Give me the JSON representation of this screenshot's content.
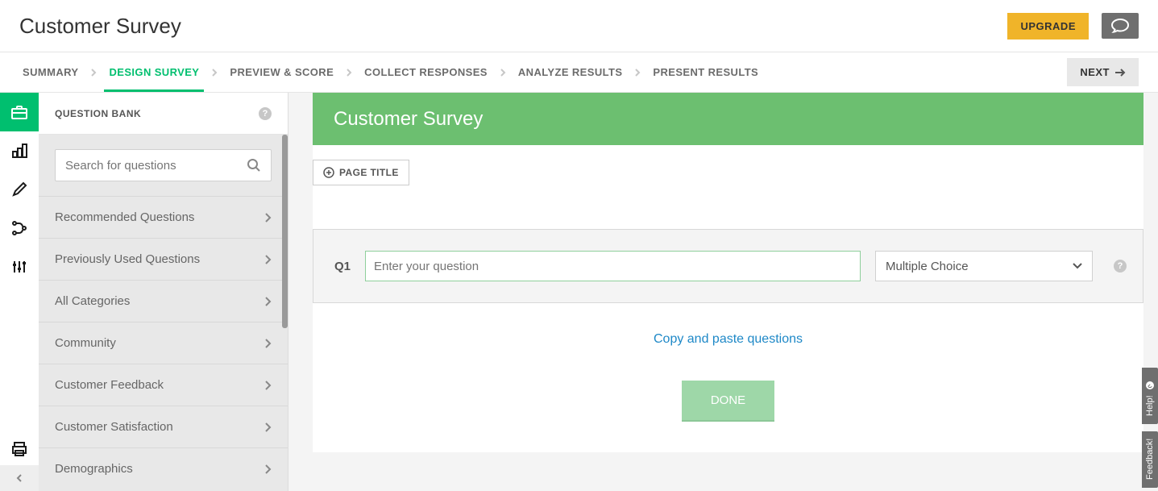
{
  "header": {
    "title": "Customer Survey",
    "upgrade": "UPGRADE"
  },
  "nav": {
    "tabs": [
      {
        "label": "SUMMARY"
      },
      {
        "label": "DESIGN SURVEY"
      },
      {
        "label": "PREVIEW & SCORE"
      },
      {
        "label": "COLLECT RESPONSES"
      },
      {
        "label": "ANALYZE RESULTS"
      },
      {
        "label": "PRESENT RESULTS"
      }
    ],
    "active_index": 1,
    "next": "NEXT"
  },
  "qbank": {
    "title": "QUESTION BANK",
    "search_placeholder": "Search for questions",
    "items": [
      {
        "label": "Recommended Questions"
      },
      {
        "label": "Previously Used Questions"
      },
      {
        "label": "All Categories"
      },
      {
        "label": "Community"
      },
      {
        "label": "Customer Feedback"
      },
      {
        "label": "Customer Satisfaction"
      },
      {
        "label": "Demographics"
      }
    ]
  },
  "survey": {
    "banner_title": "Customer Survey",
    "page_title_btn": "PAGE TITLE",
    "q_label": "Q1",
    "q_placeholder": "Enter your question",
    "q_type": "Multiple Choice",
    "copy_paste": "Copy and paste questions",
    "done": "DONE"
  },
  "float": {
    "help": "Help!",
    "feedback": "Feedback!"
  }
}
